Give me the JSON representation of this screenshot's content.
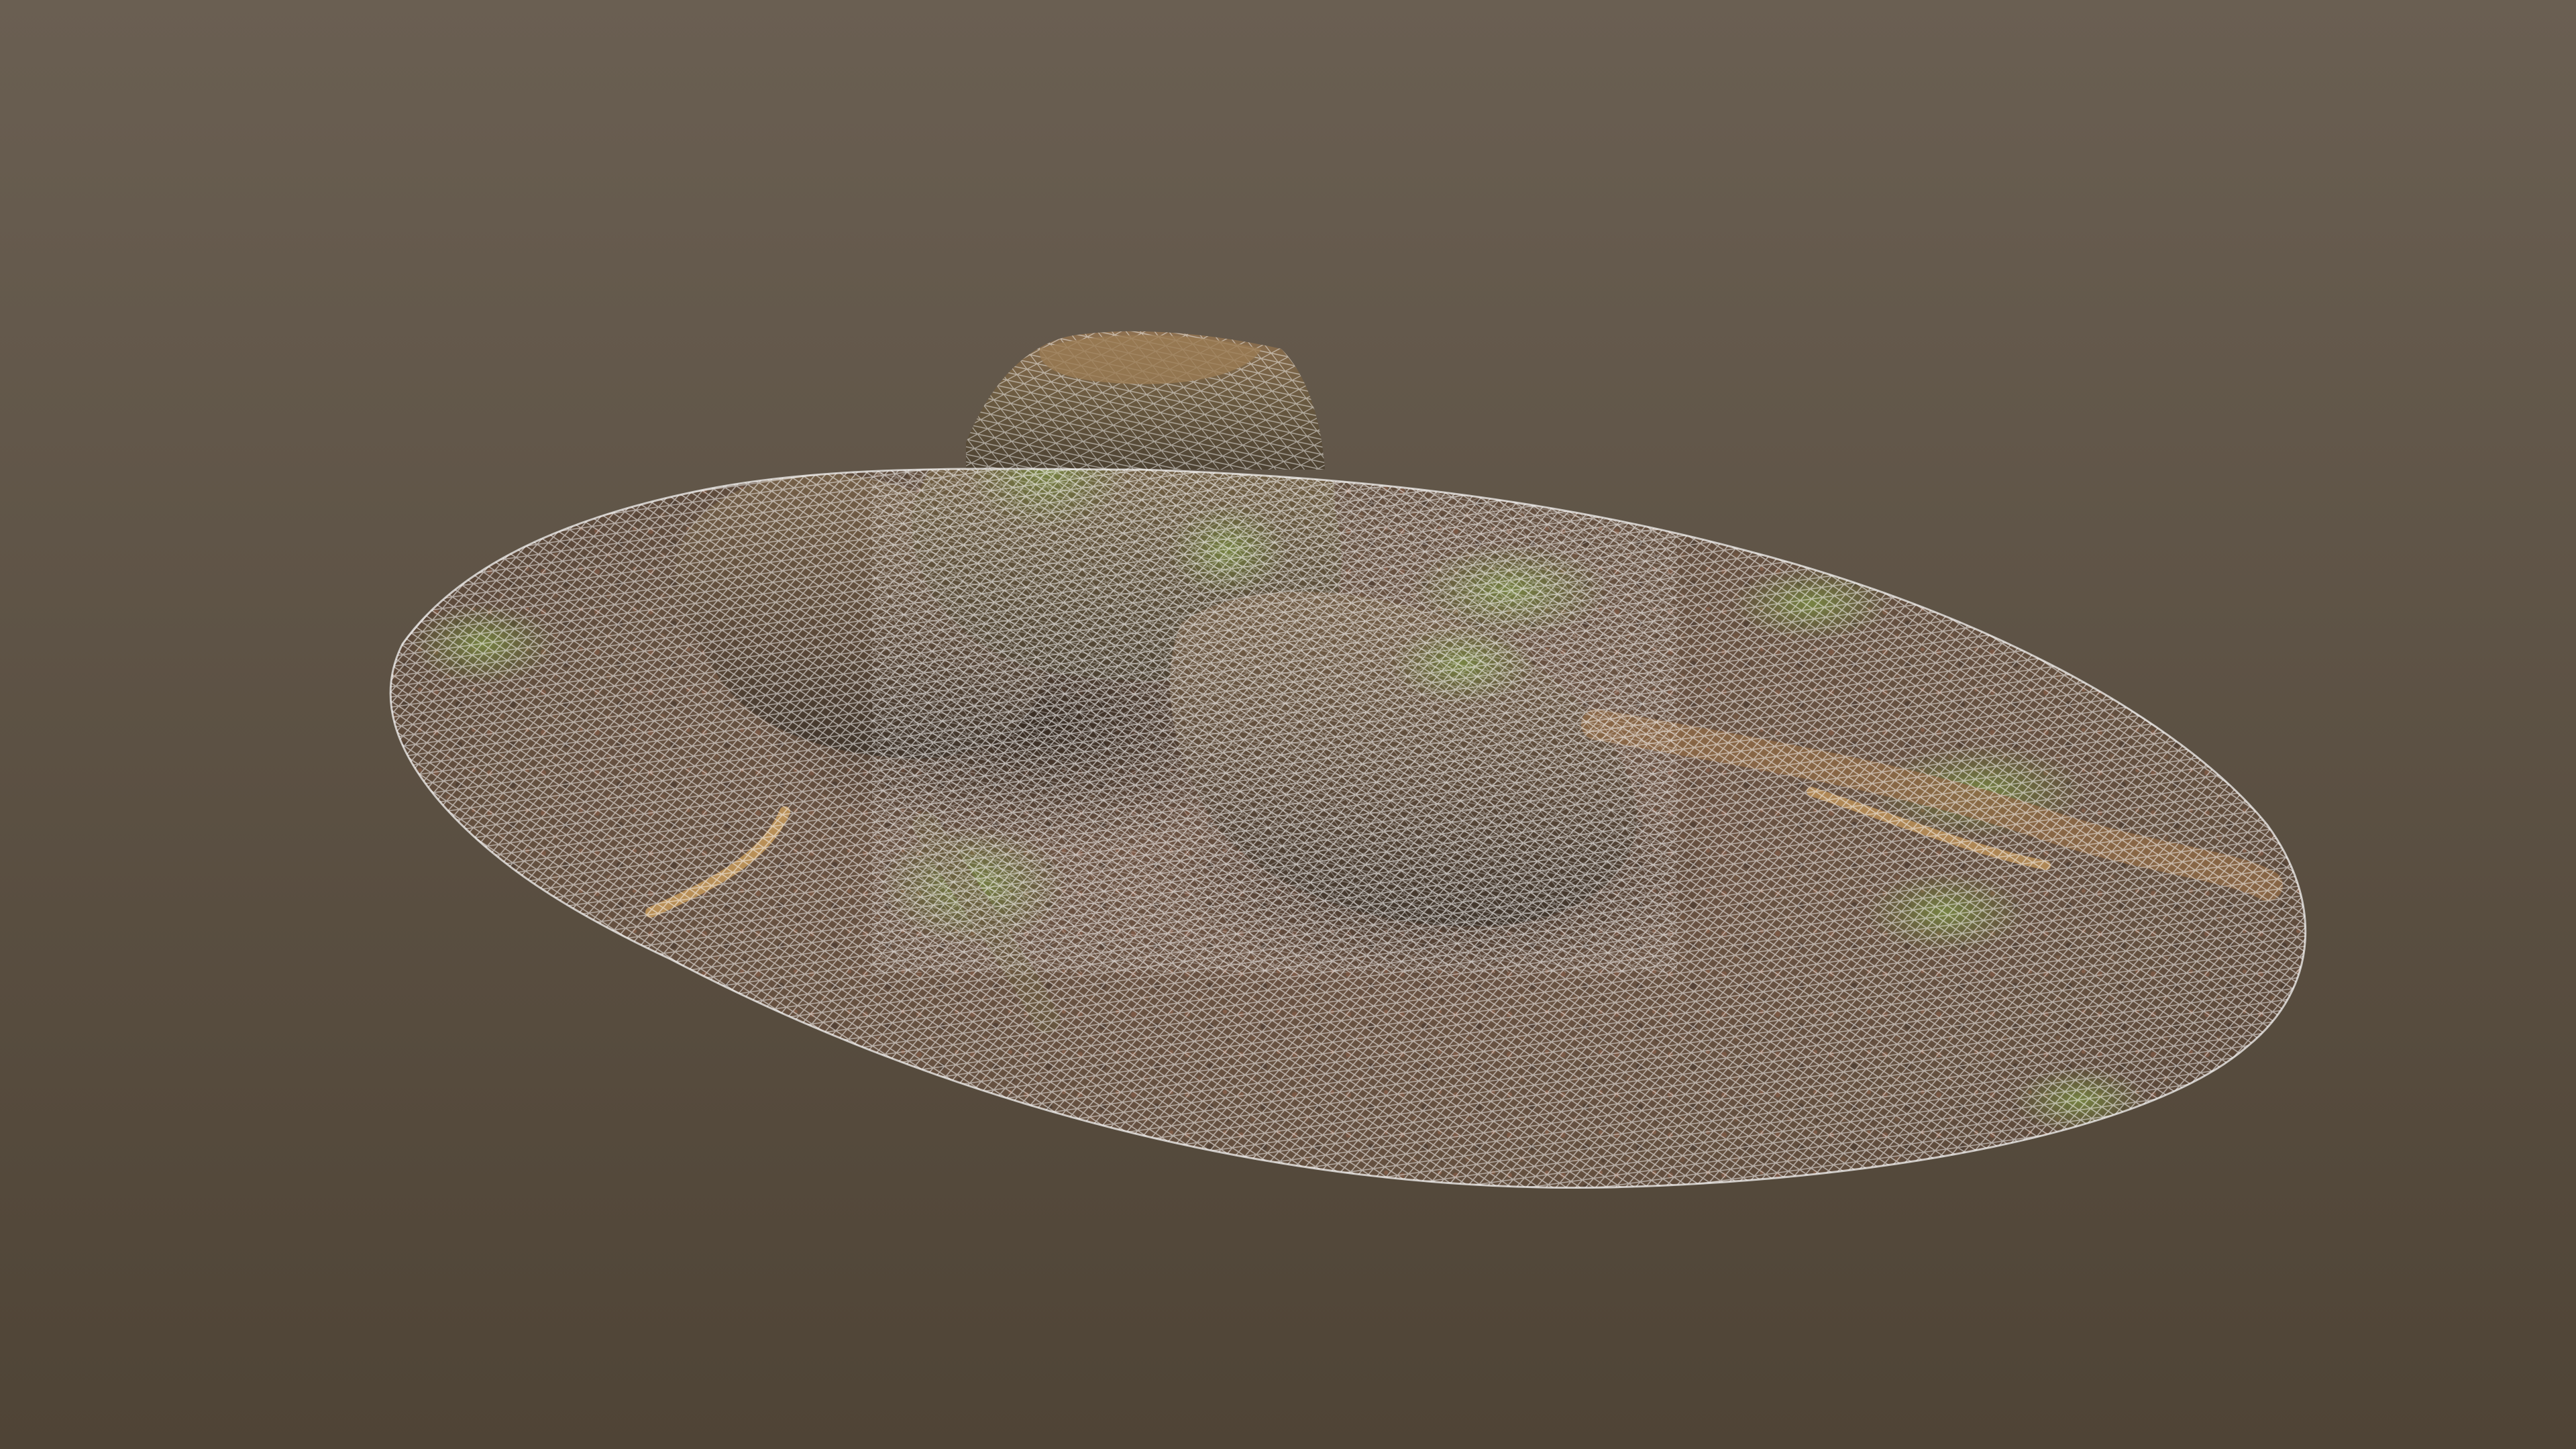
{
  "scene": {
    "subject": "photogrammetry-scan-tree-stump-wireframe",
    "render_mode": "textured-wireframe",
    "colors": {
      "background_top": "#6a5f52",
      "background_bottom": "#4f4436",
      "wire": "#ffffff",
      "soil": "#6e5444",
      "soil_dark": "#4a3a30",
      "moss": "#6c7a3e",
      "wood": "#8a6a48",
      "root": "#c79a5c"
    }
  }
}
